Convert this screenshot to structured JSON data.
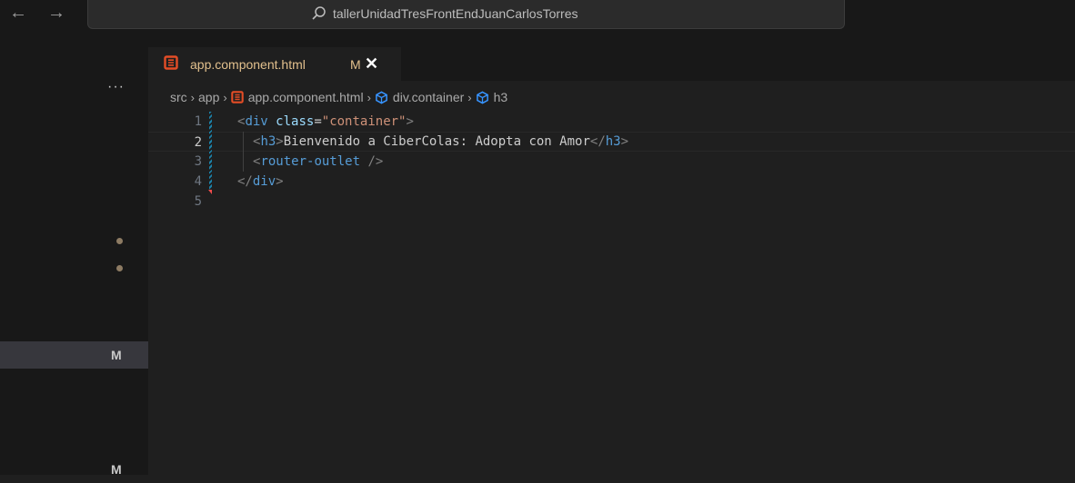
{
  "titlebar": {
    "back_icon": "arrow-left-icon",
    "forward_icon": "arrow-right-icon",
    "search_icon": "search-icon",
    "search_text": "tallerUnidadTresFrontEndJuanCarlosTorres"
  },
  "sidebar": {
    "more_label": "···",
    "scm_badges": [
      "M",
      "M"
    ]
  },
  "tab": {
    "icon": "html5-icon",
    "name": "app.component.html",
    "status": "M",
    "close": "✕"
  },
  "breadcrumb": {
    "items": [
      "src",
      "app",
      "app.component.html",
      "div.container",
      "h3"
    ],
    "separator": "›"
  },
  "code": {
    "line_numbers": [
      "1",
      "2",
      "3",
      "4",
      "5"
    ],
    "lines": {
      "l1": {
        "open": "<",
        "tag": "div",
        "attr": "class",
        "eq": "=",
        "str": "\"container\"",
        "close": ">"
      },
      "l2": {
        "open": "<",
        "tag": "h3",
        "close": ">",
        "text": "Bienvenido a CiberColas: Adopta con Amor",
        "end_open": "</",
        "end_tag": "h3",
        "end_close": ">"
      },
      "l3": {
        "open": "<",
        "tag": "router-outlet",
        "close": " />"
      },
      "l4": {
        "open": "</",
        "tag": "div",
        "close": ">"
      }
    }
  },
  "colors": {
    "modified": "#e2c08d",
    "tag": "#569cd6",
    "attribute": "#9cdcfe",
    "string": "#ce9178",
    "html_icon": "#e44d26"
  }
}
